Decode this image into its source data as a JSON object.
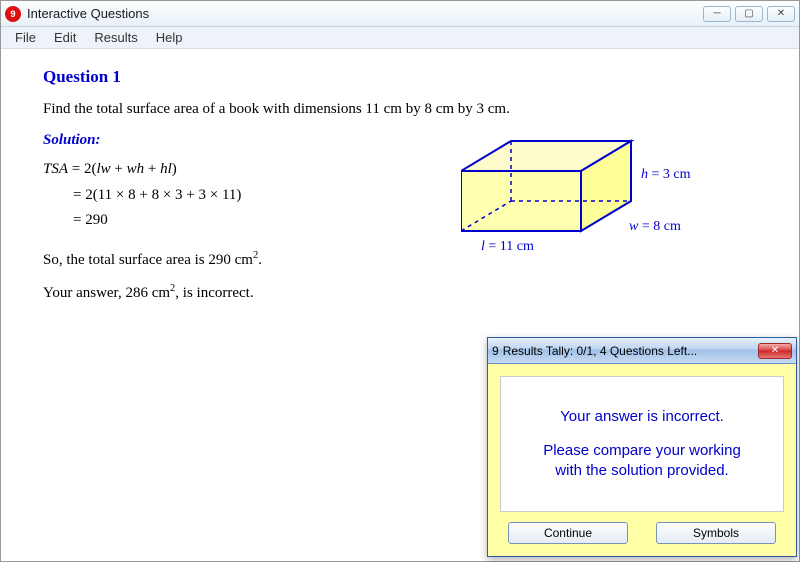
{
  "window": {
    "title": "Interactive Questions",
    "menu": [
      "File",
      "Edit",
      "Results",
      "Help"
    ]
  },
  "question": {
    "heading": "Question 1",
    "prompt": "Find the total surface area of a book with dimensions 11 cm by 8 cm by 3 cm.",
    "solution_label": "Solution:",
    "work_lhs": "TSA",
    "work_line1": " = 2(lw + wh + hl)",
    "work_line2": "= 2(11 × 8 + 8 × 3 + 3 × 11)",
    "work_line3": "= 290",
    "result_pre": "So, the total surface area is ",
    "result_val": "290 cm",
    "result_exp": "2",
    "result_post": ".",
    "your_pre": "Your answer, ",
    "your_val": "286 cm",
    "your_exp": "2",
    "your_post": ", is incorrect."
  },
  "diagram": {
    "l_label": "l = 11 cm",
    "w_label": "w = 8 cm",
    "h_label": "h = 3 cm"
  },
  "popup": {
    "title": "Results Tally:  0/1, 4 Questions Left...",
    "msg1": "Your answer is incorrect.",
    "msg2a": "Please compare your working",
    "msg2b": "with the solution provided.",
    "continue": "Continue",
    "symbols": "Symbols"
  }
}
